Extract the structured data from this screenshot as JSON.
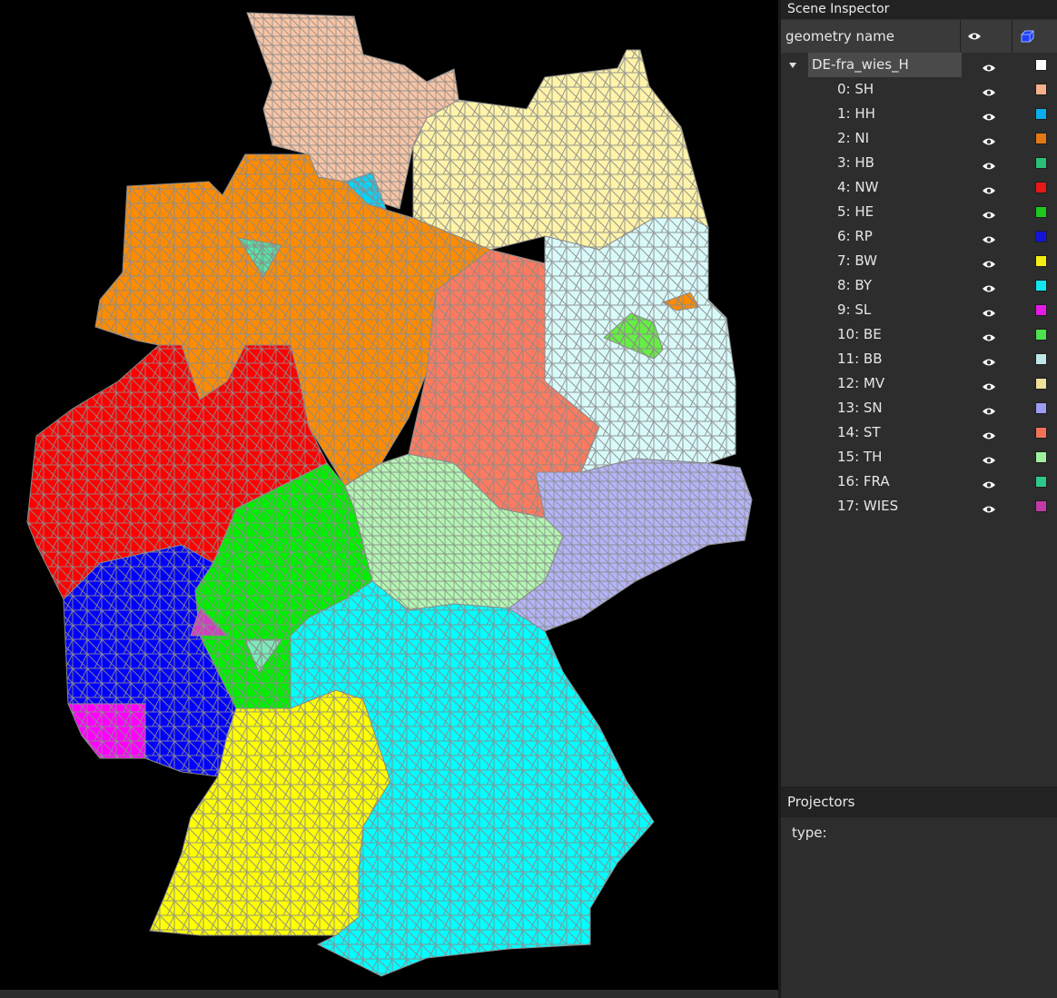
{
  "viewport": {
    "background": "#000000",
    "mesh_color": "#8a8a8a"
  },
  "inspector": {
    "title": "Scene Inspector",
    "column_name": "geometry name",
    "column_visibility_icon": "eye-icon",
    "column_color_icon": "cube-icon",
    "root": {
      "label": "DE-fra_wies_H",
      "color": "#ffffff",
      "expanded": true
    },
    "items": [
      {
        "label": "0: SH",
        "color": "#f6b08e"
      },
      {
        "label": "1: HH",
        "color": "#0aaeea"
      },
      {
        "label": "2: NI",
        "color": "#e37713"
      },
      {
        "label": "3: HB",
        "color": "#2bbf77"
      },
      {
        "label": "4: NW",
        "color": "#e81818"
      },
      {
        "label": "5: HE",
        "color": "#1ec81e"
      },
      {
        "label": "6: RP",
        "color": "#1414d8"
      },
      {
        "label": "7: BW",
        "color": "#f2ee12"
      },
      {
        "label": "8: BY",
        "color": "#12e6ee"
      },
      {
        "label": "9: SL",
        "color": "#e61ae6"
      },
      {
        "label": "10: BE",
        "color": "#4fe04f"
      },
      {
        "label": "11: BB",
        "color": "#bfe6e6"
      },
      {
        "label": "12: MV",
        "color": "#efe09a"
      },
      {
        "label": "13: SN",
        "color": "#9c9cf0"
      },
      {
        "label": "14: ST",
        "color": "#f07258"
      },
      {
        "label": "15: TH",
        "color": "#9ef09e"
      },
      {
        "label": "16: FRA",
        "color": "#2ec98a"
      },
      {
        "label": "17: WIES",
        "color": "#c23aa8"
      }
    ]
  },
  "projectors": {
    "title": "Projectors",
    "type_label": "type:"
  }
}
